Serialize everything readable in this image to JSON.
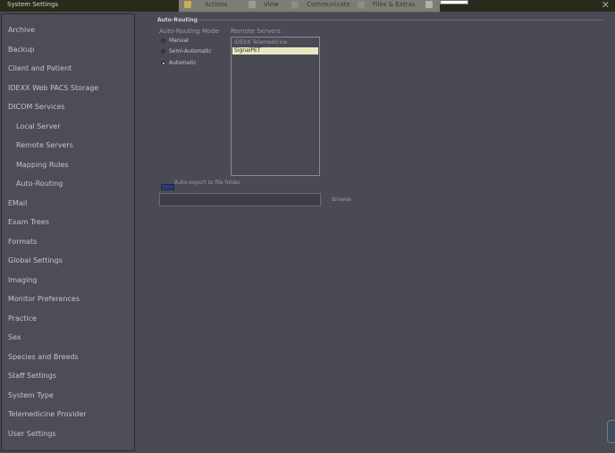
{
  "window": {
    "title": "System Settings"
  },
  "background_toolbar": {
    "items": [
      {
        "label": "Actions"
      },
      {
        "label": "View"
      },
      {
        "label": "Communicate"
      },
      {
        "label": "Files & Extras"
      }
    ]
  },
  "sidebar": {
    "items": [
      {
        "label": "Archive"
      },
      {
        "label": "Backup"
      },
      {
        "label": "Client and Patient"
      },
      {
        "label": "IDEXX Web PACS Storage"
      },
      {
        "label": "DICOM Services"
      },
      {
        "label": "Local Server"
      },
      {
        "label": "Remote Servers"
      },
      {
        "label": "Mapping Rules"
      },
      {
        "label": "Auto-Routing"
      },
      {
        "label": "EMail"
      },
      {
        "label": "Exam Trees"
      },
      {
        "label": "Formats"
      },
      {
        "label": "Global Settings"
      },
      {
        "label": "Imaging"
      },
      {
        "label": "Monitor Preferences"
      },
      {
        "label": "Practice"
      },
      {
        "label": "Sex"
      },
      {
        "label": "Species and Breeds"
      },
      {
        "label": "Staff Settings"
      },
      {
        "label": "System Type"
      },
      {
        "label": "Telemedicine Provider"
      },
      {
        "label": "User Settings"
      }
    ]
  },
  "main": {
    "section_title": "Auto-Routing",
    "mode_label": "Auto-Routing Mode",
    "servers_label": "Remote Servers",
    "modes": [
      {
        "label": "Manual",
        "checked": false
      },
      {
        "label": "Semi-Automatic",
        "checked": false
      },
      {
        "label": "Automatic",
        "checked": true
      }
    ],
    "servers": [
      {
        "label": "IDEXX Telemedicine",
        "selected": false
      },
      {
        "label": "SignalPET",
        "selected": true
      }
    ],
    "auto_export_label": "Auto-export to file folder",
    "auto_export_checked": true,
    "folder_path": "",
    "browse_label": "Browse"
  }
}
